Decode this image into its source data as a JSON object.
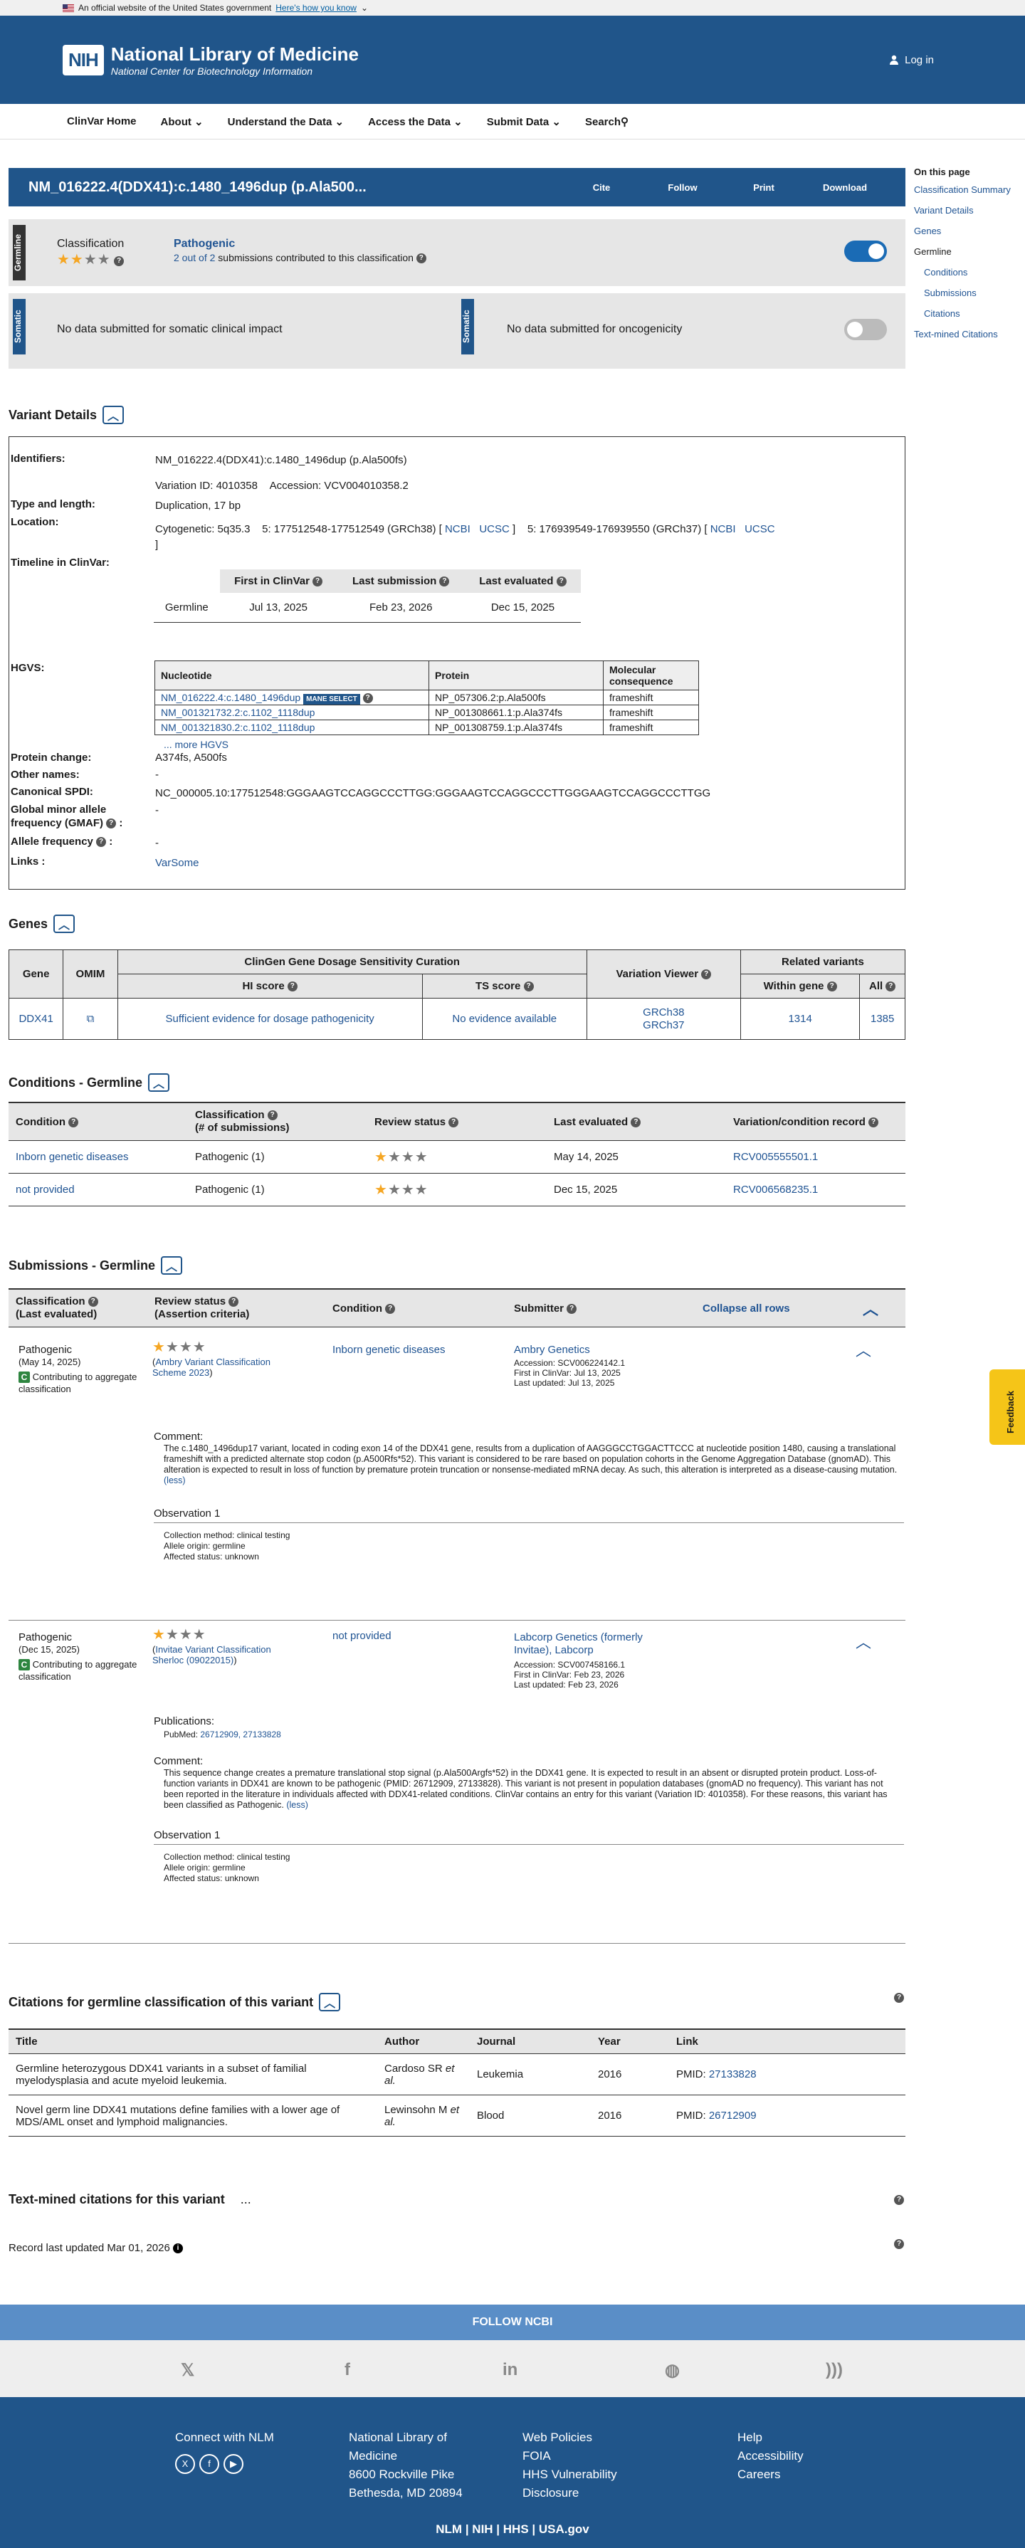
{
  "gov_banner": {
    "text": "An official website of the United States government",
    "link": "Here's how you know"
  },
  "header": {
    "logo_abbr": "NIH",
    "title": "National Library of Medicine",
    "subtitle": "National Center for Biotechnology Information",
    "login": "Log in"
  },
  "nav": [
    "ClinVar Home",
    "About",
    "Understand the Data",
    "Access the Data",
    "Submit Data",
    "Search"
  ],
  "variant": {
    "title": "NM_016222.4(DDX41):c.1480_1496dup (p.Ala500...",
    "actions": [
      "Cite",
      "Follow",
      "Print",
      "Download"
    ]
  },
  "on_this_page": {
    "heading": "On this page",
    "items": [
      "Classification Summary",
      "Variant Details",
      "Genes",
      "Germline",
      "Conditions",
      "Submissions",
      "Citations",
      "Text-mined Citations"
    ]
  },
  "germline_panel": {
    "label": "Germline",
    "classification_label": "Classification",
    "classification": "Pathogenic",
    "submissions": "2 out of 2",
    "submissions_suffix": "submissions contributed to this classification"
  },
  "somatic_panel": {
    "label": "Somatic",
    "clinical_impact": "No data submitted for somatic clinical impact",
    "oncogenicity": "No data submitted for oncogenicity"
  },
  "variant_details": {
    "title": "Variant Details",
    "identifiers_label": "Identifiers:",
    "identifier": "NM_016222.4(DDX41):c.1480_1496dup (p.Ala500fs)",
    "variation_id": "Variation ID: 4010358",
    "accession": "Accession: VCV004010358.2",
    "type_label": "Type and length:",
    "type": "Duplication, 17 bp",
    "location_label": "Location:",
    "cytogenetic": "Cytogenetic: 5q35.3",
    "grch38": "5: 177512548-177512549 (GRCh38) [",
    "grch37": "5: 176939549-176939550 (GRCh37) [",
    "ncbi": "NCBI",
    "ucsc": "UCSC",
    "timeline_label": "Timeline in ClinVar:",
    "timeline_headers": [
      "First in ClinVar",
      "Last submission",
      "Last evaluated"
    ],
    "timeline_row": {
      "label": "Germline",
      "first": "Jul 13, 2025",
      "last_sub": "Feb 23, 2026",
      "last_eval": "Dec 15, 2025"
    },
    "hgvs_label": "HGVS:",
    "hgvs_headers": [
      "Nucleotide",
      "Protein",
      "Molecular consequence"
    ],
    "hgvs_rows": [
      {
        "nuc": "NM_016222.4:c.1480_1496dup",
        "prot": "NP_057306.2:p.Ala500fs",
        "cons": "frameshift"
      },
      {
        "nuc": "NM_001321732.2:c.1102_1118dup",
        "prot": "NP_001308661.1:p.Ala374fs",
        "cons": "frameshift"
      },
      {
        "nuc": "NM_001321830.2:c.1102_1118dup",
        "prot": "NP_001308759.1:p.Ala374fs",
        "cons": "frameshift"
      }
    ],
    "mane_select": "MANE SELECT",
    "more_hgvs": "... more HGVS",
    "protein_change_label": "Protein change:",
    "protein_change": "A374fs, A500fs",
    "other_names_label": "Other names:",
    "other_names": "-",
    "spdi_label": "Canonical SPDI:",
    "spdi": "NC_000005.10:177512548:GGGAAGTCCAGGCCCTTGG:GGGAAGTCCAGGCCCTTGGGAAGTCCAGGCCCTTGG",
    "gmaf_label": "Global minor allele frequency (GMAF)",
    "gmaf": "-",
    "allele_freq_label": "Allele frequency",
    "allele_freq": "-",
    "links_label": "Links :",
    "links": "VarSome"
  },
  "genes": {
    "title": "Genes",
    "group_header": "ClinGen Gene Dosage Sensitivity Curation",
    "related_header": "Related variants",
    "headers": [
      "Gene",
      "OMIM",
      "HI score",
      "TS score",
      "Variation Viewer",
      "Within gene",
      "All"
    ],
    "row": {
      "gene": "DDX41",
      "hi": "Sufficient evidence for dosage pathogenicity",
      "ts": "No evidence available",
      "vv1": "GRCh38",
      "vv2": "GRCh37",
      "within": "1314",
      "all": "1385"
    }
  },
  "conditions": {
    "title": "Conditions - Germline",
    "headers": [
      "Condition",
      "Classification",
      "(# of submissions)",
      "Review status",
      "Last evaluated",
      "Variation/condition record"
    ],
    "rows": [
      {
        "condition": "Inborn genetic diseases",
        "classification": "Pathogenic (1)",
        "last_eval": "May 14, 2025",
        "record": "RCV005555501.1"
      },
      {
        "condition": "not provided",
        "classification": "Pathogenic (1)",
        "last_eval": "Dec 15, 2025",
        "record": "RCV006568235.1"
      }
    ]
  },
  "submissions": {
    "title": "Submissions - Germline",
    "headers": [
      "Classification",
      "(Last evaluated)",
      "Review status",
      "(Assertion criteria)",
      "Condition",
      "Submitter"
    ],
    "collapse_all": "Collapse all rows",
    "contributing": "Contributing to aggregate classification",
    "items": [
      {
        "classification": "Pathogenic",
        "date": "(May 14, 2025)",
        "criteria": "Ambry Variant Classification Scheme 2023",
        "condition": "Inborn genetic diseases",
        "submitter": "Ambry Genetics",
        "accession": "Accession: SCV006224142.1",
        "first": "First in ClinVar: Jul 13, 2025",
        "updated": "Last updated: Jul 13, 2025",
        "comment": "The c.1480_1496dup17 variant, located in coding exon 14 of the DDX41 gene, results from a duplication of AAGGGCCTGGACTTCCC at nucleotide position 1480, causing a translational frameshift with a predicted alternate stop codon (p.A500Rfs*52). This variant is considered to be rare based on population cohorts in the Genome Aggregation Database (gnomAD). This alteration is expected to result in loss of function by premature protein truncation or nonsense-mediated mRNA decay. As such, this alteration is interpreted as a disease-causing mutation.",
        "method": "Collection method: clinical testing",
        "origin": "Allele origin: germline",
        "affected": "Affected status: unknown"
      },
      {
        "classification": "Pathogenic",
        "date": "(Dec 15, 2025)",
        "criteria": "Invitae Variant Classification Sherloc (09022015)",
        "condition": "not provided",
        "submitter": "Labcorp Genetics (formerly Invitae), Labcorp",
        "accession": "Accession: SCV007458166.1",
        "first": "First in ClinVar: Feb 23, 2026",
        "updated": "Last updated: Feb 23, 2026",
        "publications": "PubMed:",
        "pmids": "26712909, 27133828",
        "comment": "This sequence change creates a premature translational stop signal (p.Ala500Argfs*52) in the DDX41 gene. It is expected to result in an absent or disrupted protein product. Loss-of-function variants in DDX41 are known to be pathogenic (PMID: 26712909, 27133828). This variant is not present in population databases (gnomAD no frequency). This variant has not been reported in the literature in individuals affected with DDX41-related conditions. ClinVar contains an entry for this variant (Variation ID: 4010358). For these reasons, this variant has been classified as Pathogenic.",
        "method": "Collection method: clinical testing",
        "origin": "Allele origin: germline",
        "affected": "Affected status: unknown"
      }
    ],
    "comment_label": "Comment:",
    "observation_label": "Observation 1",
    "publications_label": "Publications:",
    "less": "(less)"
  },
  "citations": {
    "title": "Citations for germline classification of this variant",
    "headers": [
      "Title",
      "Author",
      "Journal",
      "Year",
      "Link"
    ],
    "rows": [
      {
        "title": "Germline heterozygous DDX41 variants in a subset of familial myelodysplasia and acute myeloid leukemia.",
        "author": "Cardoso SR",
        "etal": "et al.",
        "journal": "Leukemia",
        "year": "2016",
        "pmid_label": "PMID:",
        "pmid": "27133828"
      },
      {
        "title": "Novel germ line DDX41 mutations define families with a lower age of MDS/AML onset and lymphoid malignancies.",
        "author": "Lewinsohn M",
        "etal": "et al.",
        "journal": "Blood",
        "year": "2016",
        "pmid_label": "PMID:",
        "pmid": "26712909"
      }
    ]
  },
  "text_mined": {
    "title": "Text-mined citations for this variant",
    "ellipsis": "..."
  },
  "record_updated": "Record last updated Mar 01, 2026",
  "feedback": "Feedback",
  "footer": {
    "follow": "FOLLOW NCBI",
    "connect": "Connect with NLM",
    "address": [
      "National Library of",
      "Medicine",
      "8600 Rockville Pike",
      "Bethesda, MD 20894"
    ],
    "policies": [
      "Web Policies",
      "FOIA",
      "HHS Vulnerability",
      "Disclosure"
    ],
    "help": [
      "Help",
      "Accessibility",
      "Careers"
    ],
    "bottom": [
      "NLM",
      "NIH",
      "HHS",
      "USA.gov"
    ]
  }
}
